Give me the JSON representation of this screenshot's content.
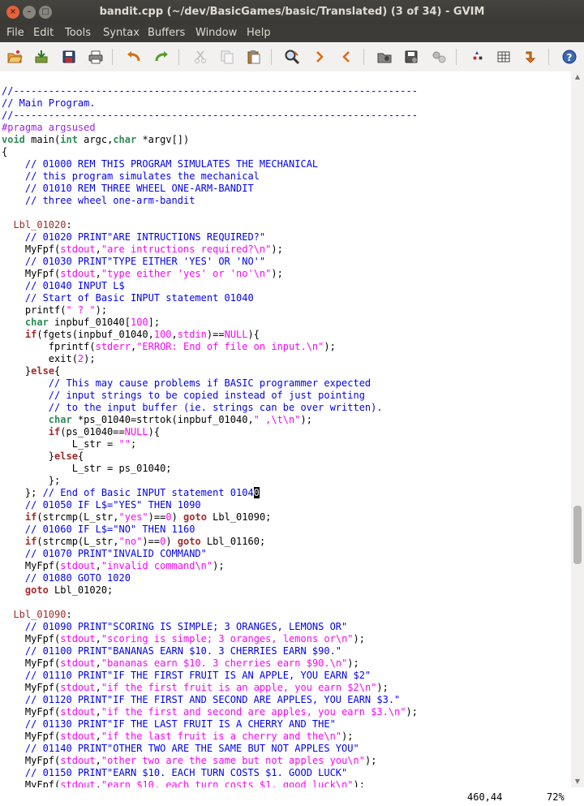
{
  "window": {
    "title": "bandit.cpp (~/dev/BasicGames/basic/Translated) (3 of 34) - GVIM",
    "close_glyph": "×",
    "min_glyph": "–",
    "max_glyph": "□"
  },
  "menu": {
    "file": "File",
    "edit": "Edit",
    "tools": "Tools",
    "syntax": "Syntax",
    "buffers": "Buffers",
    "window": "Window",
    "help": "Help"
  },
  "toolbar_icons": [
    "open-icon",
    "save-icon",
    "save-all-icon",
    "print-icon",
    "undo-icon",
    "redo-icon",
    "cut-icon",
    "copy-icon",
    "paste-icon",
    "find-replace-icon",
    "find-next-icon",
    "find-prev-icon",
    "load-session-icon",
    "save-session-icon",
    "run-script-icon",
    "make-icon",
    "shell-icon",
    "tag-jump-icon",
    "help-icon"
  ],
  "code": {
    "l01": "//---------------------------------------------------------------------",
    "l02": "// Main Program.",
    "l03": "//---------------------------------------------------------------------",
    "l04": "#pragma argsused",
    "l05_t1": "void",
    "l05_a": " main(",
    "l05_t2": "int",
    "l05_b": " argc,",
    "l05_t3": "char",
    "l05_c": " *argv[])",
    "l06": "{",
    "l07": "// 01000 REM THIS PROGRAM SIMULATES THE MECHANICAL",
    "l08": "// this program simulates the mechanical",
    "l09": "// 01010 REM THREE WHEEL ONE-ARM-BANDIT",
    "l10": "// three wheel one-arm-bandit",
    "l12_lbl": "Lbl_01020",
    "l12_colon": ":",
    "l13": "// 01020 PRINT\"ARE INTRUCTIONS REQUIRED?\"",
    "l14_a": "MyFpf(",
    "l14_b": "stdout",
    "l14_c": ",",
    "l14_s": "\"are intructions required?\\n\"",
    "l14_d": ");",
    "l15": "// 01030 PRINT\"TYPE EITHER 'YES' OR 'NO'\"",
    "l16_a": "MyFpf(",
    "l16_b": "stdout",
    "l16_c": ",",
    "l16_s": "\"type either 'yes' or 'no'\\n\"",
    "l16_d": ");",
    "l17": "// 01040 INPUT L$",
    "l18": "// Start of Basic INPUT statement 01040",
    "l19_a": "printf(",
    "l19_s": "\" ? \"",
    "l19_b": ");",
    "l20_t": "char",
    "l20_a": " inpbuf_01040[",
    "l20_n": "100",
    "l20_b": "];",
    "l21_k": "if",
    "l21_a": "(fgets(inpbuf_01040,",
    "l21_n": "100",
    "l21_b": ",",
    "l21_c": "stdin",
    "l21_d": ")==",
    "l21_e": "NULL",
    "l21_f": "){",
    "l22_a": "fprintf(",
    "l22_b": "stderr",
    "l22_c": ",",
    "l22_s": "\"ERROR: End of file on input.\\n\"",
    "l22_d": ");",
    "l23_a": "exit(",
    "l23_n": "2",
    "l23_b": ");",
    "l24_a": "}",
    "l24_k": "else",
    "l24_b": "{",
    "l25": "// This may cause problems if BASIC programmer expected",
    "l26": "// input strings to be copied instead of just pointing",
    "l27": "// to the input buffer (ie. strings can be over written).",
    "l28_t": "char",
    "l28_a": " *ps_01040=strtok(inpbuf_01040,",
    "l28_s": "\" ,\\t\\n\"",
    "l28_b": ");",
    "l29_k": "if",
    "l29_a": "(ps_01040==",
    "l29_n": "NULL",
    "l29_b": "){",
    "l30_a": "L_str = ",
    "l30_s": "\"\"",
    "l30_b": ";",
    "l31_a": "}",
    "l31_k": "else",
    "l31_b": "{",
    "l32": "L_str = ps_01040;",
    "l33": "};",
    "l34_a": "};",
    "l34_c": " // End of Basic INPUT statement 0104",
    "l34_cur": "0",
    "l35": "// 01050 IF L$=\"YES\" THEN 1090",
    "l36_k1": "if",
    "l36_a": "(strcmp(L_str,",
    "l36_s": "\"yes\"",
    "l36_b": ")==",
    "l36_n": "0",
    "l36_c": ") ",
    "l36_k2": "goto",
    "l36_d": " Lbl_01090;",
    "l37": "// 01060 IF L$=\"NO\" THEN 1160",
    "l38_k1": "if",
    "l38_a": "(strcmp(L_str,",
    "l38_s": "\"no\"",
    "l38_b": ")==",
    "l38_n": "0",
    "l38_c": ") ",
    "l38_k2": "goto",
    "l38_d": " Lbl_01160;",
    "l39": "// 01070 PRINT\"INVALID COMMAND\"",
    "l40_a": "MyFpf(",
    "l40_b": "stdout",
    "l40_c": ",",
    "l40_s": "\"invalid command\\n\"",
    "l40_d": ");",
    "l41": "// 01080 GOTO 1020",
    "l42_k": "goto",
    "l42_a": " Lbl_01020;",
    "l44_lbl": "Lbl_01090",
    "l44_colon": ":",
    "l45": "// 01090 PRINT\"SCORING IS SIMPLE; 3 ORANGES, LEMONS OR\"",
    "l46_a": "MyFpf(",
    "l46_b": "stdout",
    "l46_c": ",",
    "l46_s": "\"scoring is simple; 3 oranges, lemons or\\n\"",
    "l46_d": ");",
    "l47": "// 01100 PRINT\"BANANAS EARN $10. 3 CHERRIES EARN $90.\"",
    "l48_a": "MyFpf(",
    "l48_b": "stdout",
    "l48_c": ",",
    "l48_s": "\"bananas earn $10. 3 cherries earn $90.\\n\"",
    "l48_d": ");",
    "l49": "// 01110 PRINT\"IF THE FIRST FRUIT IS AN APPLE, YOU EARN $2\"",
    "l50_a": "MyFpf(",
    "l50_b": "stdout",
    "l50_c": ",",
    "l50_s": "\"if the first fruit is an apple, you earn $2\\n\"",
    "l50_d": ");",
    "l51": "// 01120 PRINT\"IF THE FIRST AND SECOND ARE APPLES, YOU EARN $3.\"",
    "l52_a": "MyFpf(",
    "l52_b": "stdout",
    "l52_c": ",",
    "l52_s": "\"if the first and second are apples, you earn $3.\\n\"",
    "l52_d": ");",
    "l53": "// 01130 PRINT\"IF THE LAST FRUIT IS A CHERRY AND THE\"",
    "l54_a": "MyFpf(",
    "l54_b": "stdout",
    "l54_c": ",",
    "l54_s": "\"if the last fruit is a cherry and the\\n\"",
    "l54_d": ");",
    "l55": "// 01140 PRINT\"OTHER TWO ARE THE SAME BUT NOT APPLES YOU\"",
    "l56_a": "MyFpf(",
    "l56_b": "stdout",
    "l56_c": ",",
    "l56_s": "\"other two are the same but not apples you\\n\"",
    "l56_d": ");",
    "l57": "// 01150 PRINT\"EARN $10. EACH TURN COSTS $1. GOOD LUCK\"",
    "l58_a": "MyFpf(",
    "l58_b": "stdout",
    "l58_c": ",",
    "l58_s": "\"earn $10. each turn costs $1. good luck\\n\"",
    "l58_d": ");"
  },
  "status": {
    "position": "460,44",
    "percent": "72%"
  },
  "colors": {
    "comment": "#0000ff",
    "preproc": "#a020f0",
    "type": "#2e8b57",
    "statement": "#a52a2a",
    "constant": "#ff00ff"
  }
}
